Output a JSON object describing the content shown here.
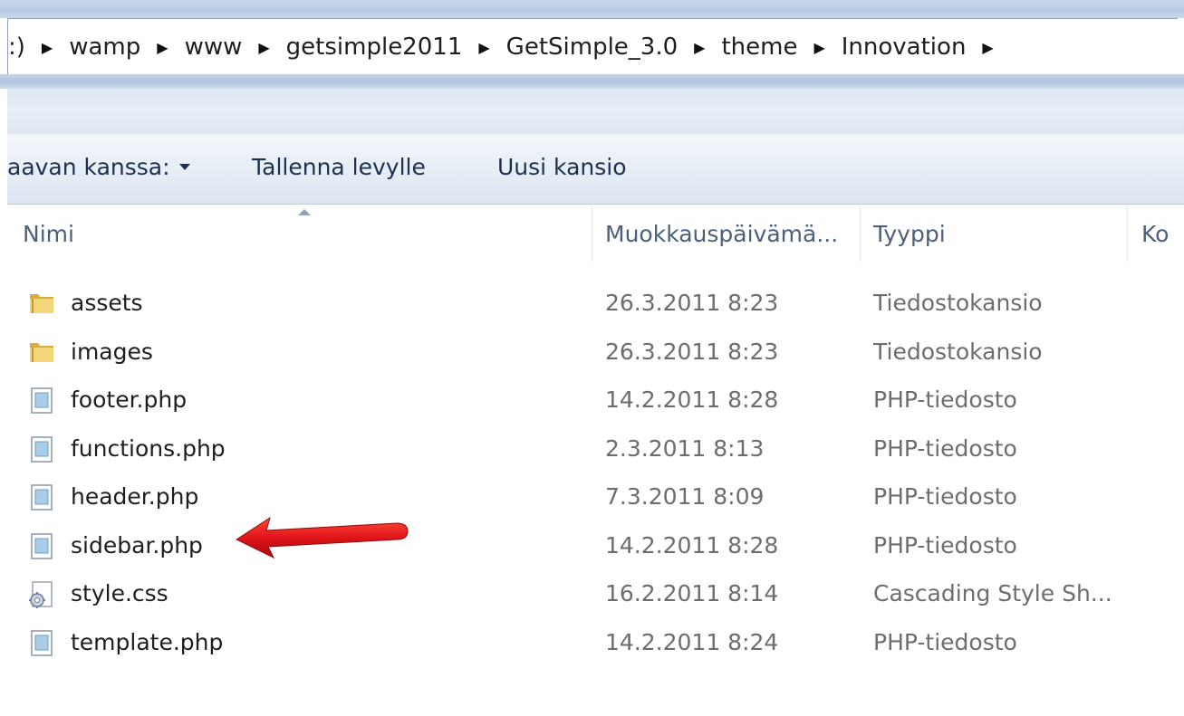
{
  "breadcrumb": {
    "items": [
      ":)",
      "wamp",
      "www",
      "getsimple2011",
      "GetSimple_3.0",
      "theme",
      "Innovation"
    ]
  },
  "toolbar": {
    "share_label": "aavan kanssa:",
    "burn_label": "Tallenna levylle",
    "new_folder_label": "Uusi kansio"
  },
  "columns": {
    "name": "Nimi",
    "date": "Muokkauspäivämä...",
    "type": "Tyyppi",
    "size": "Ko"
  },
  "files": [
    {
      "name": "assets",
      "date": "26.3.2011 8:23",
      "type": "Tiedostokansio",
      "icon": "folder-icon"
    },
    {
      "name": "images",
      "date": "26.3.2011 8:23",
      "type": "Tiedostokansio",
      "icon": "folder-icon"
    },
    {
      "name": "footer.php",
      "date": "14.2.2011 8:28",
      "type": "PHP-tiedosto",
      "icon": "php-file-icon"
    },
    {
      "name": "functions.php",
      "date": "2.3.2011 8:13",
      "type": "PHP-tiedosto",
      "icon": "php-file-icon"
    },
    {
      "name": "header.php",
      "date": "7.3.2011 8:09",
      "type": "PHP-tiedosto",
      "icon": "php-file-icon"
    },
    {
      "name": "sidebar.php",
      "date": "14.2.2011 8:28",
      "type": "PHP-tiedosto",
      "icon": "php-file-icon"
    },
    {
      "name": "style.css",
      "date": "16.2.2011 8:14",
      "type": "Cascading Style Sh...",
      "icon": "css-file-icon"
    },
    {
      "name": "template.php",
      "date": "14.2.2011 8:24",
      "type": "PHP-tiedosto",
      "icon": "php-file-icon"
    }
  ],
  "annotation": {
    "target": "sidebar.php",
    "color": "#e0141a",
    "icon": "red-arrow-icon"
  },
  "colors": {
    "toolbar_text": "#1e3050",
    "header_text": "#4c607a",
    "meta_text": "#6d6d6d",
    "folder": "#e8c25a"
  }
}
